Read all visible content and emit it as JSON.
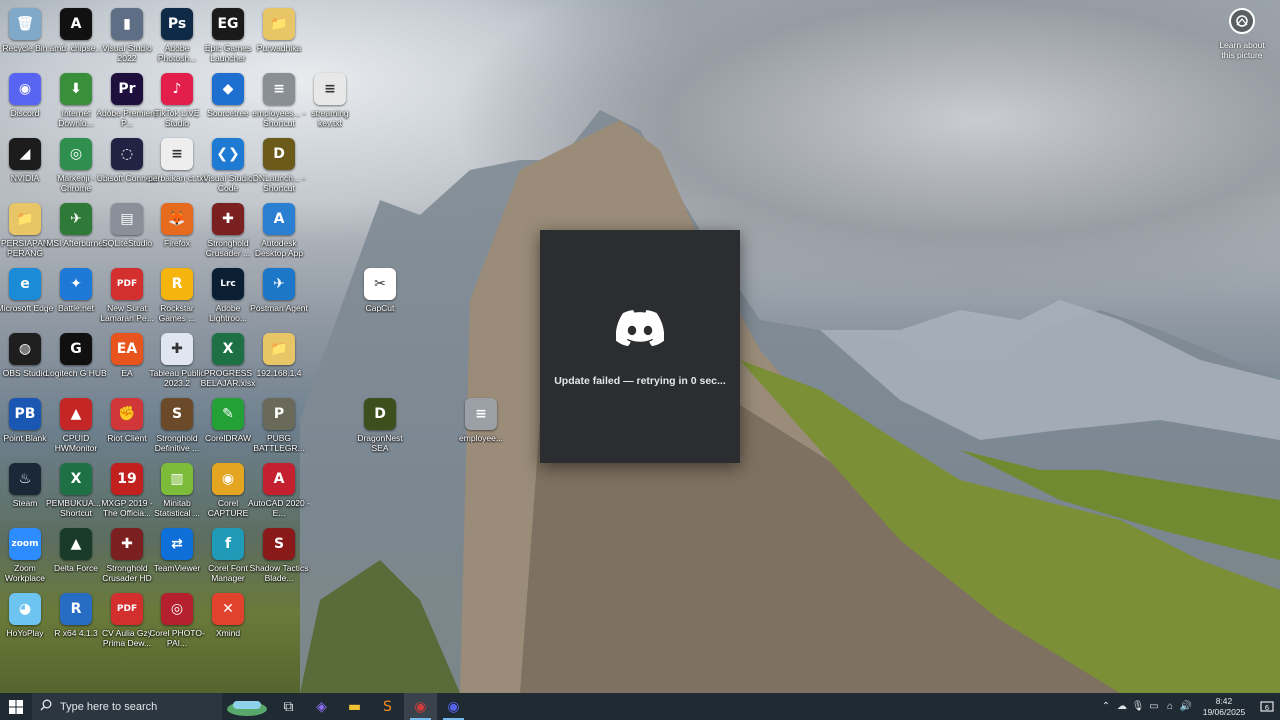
{
  "learn": {
    "label": "Learn about this picture"
  },
  "desktop_icons": [
    {
      "label": "Recycle Bin",
      "glyph": "🗑",
      "color": "#7fa8c9"
    },
    {
      "label": "amd_chipse...",
      "glyph": "A",
      "color": "#111111"
    },
    {
      "label": "Visual Studio 2022",
      "glyph": "▮",
      "color": "#5e6f85"
    },
    {
      "label": "Adobe Photosh...",
      "glyph": "Ps",
      "color": "#0e2a47"
    },
    {
      "label": "Epic Games Launcher",
      "glyph": "EG",
      "color": "#1a1a1a"
    },
    {
      "label": "Purwadhika",
      "glyph": "📁",
      "color": "#e8c667"
    },
    {
      "label": "Discord",
      "glyph": "◉",
      "color": "#5865f2"
    },
    {
      "label": "Internet Downlo...",
      "glyph": "⬇",
      "color": "#3a8f3a"
    },
    {
      "label": "Adobe Premiere P...",
      "glyph": "Pr",
      "color": "#1f0f3d"
    },
    {
      "label": "TikTok LIVE Studio",
      "glyph": "♪",
      "color": "#e41e4a"
    },
    {
      "label": "Sourcetree",
      "glyph": "◆",
      "color": "#1f6fd1"
    },
    {
      "label": "employees... - Shortcut",
      "glyph": "≡",
      "color": "#8a8f95"
    },
    {
      "label": "streaming key.txt",
      "glyph": "≡",
      "color": "#e8e8e8"
    },
    {
      "label": "NVIDIA",
      "glyph": "◢",
      "color": "#1c1c1c"
    },
    {
      "label": "Markenji - Chrome",
      "glyph": "◎",
      "color": "#2f8f4e"
    },
    {
      "label": "Ubisoft Connect",
      "glyph": "◌",
      "color": "#222244"
    },
    {
      "label": "perbaikan ct.txt",
      "glyph": "≡",
      "color": "#eeeeee"
    },
    {
      "label": "Visual Studio Code",
      "glyph": "❮❯",
      "color": "#1f7ad3"
    },
    {
      "label": "DNLaunch... - Shortcut",
      "glyph": "D",
      "color": "#6b5a1a"
    },
    {
      "label": "PERSIAPAN PERANG",
      "glyph": "📁",
      "color": "#e8c667"
    },
    {
      "label": "MSI Afterburner",
      "glyph": "✈",
      "color": "#2f7a38"
    },
    {
      "label": "SQLiteStudio",
      "glyph": "▤",
      "color": "#8a9099"
    },
    {
      "label": "Firefox",
      "glyph": "🦊",
      "color": "#e66b1f"
    },
    {
      "label": "Stronghold Crusader ...",
      "glyph": "✚",
      "color": "#7a2020"
    },
    {
      "label": "Autodesk Desktop App",
      "glyph": "A",
      "color": "#2b7fd3"
    },
    {
      "label": "CapCut",
      "glyph": "✂",
      "color": "#ffffff"
    },
    {
      "label": "Microsoft Edge",
      "glyph": "e",
      "color": "#1b8bd8"
    },
    {
      "label": "Battle.net",
      "glyph": "✦",
      "color": "#1e78d6"
    },
    {
      "label": "New Surat Lamaran Pe...",
      "glyph": "PDF",
      "color": "#d32f2f"
    },
    {
      "label": "Rockstar Games ...",
      "glyph": "R",
      "color": "#f6b40e"
    },
    {
      "label": "Adobe Lightroo...",
      "glyph": "Lrc",
      "color": "#0b1f33"
    },
    {
      "label": "Postman Agent",
      "glyph": "✈",
      "color": "#1d77c9"
    },
    {
      "label": "OBS Studio",
      "glyph": "◍",
      "color": "#1e1e1e"
    },
    {
      "label": "Logitech G HUB",
      "glyph": "G",
      "color": "#101010"
    },
    {
      "label": "EA",
      "glyph": "EA",
      "color": "#e8541e"
    },
    {
      "label": "Tableau Public 2023.2",
      "glyph": "✚",
      "color": "#dfe6ef"
    },
    {
      "label": "PROGRESS BELAJAR.xlsx",
      "glyph": "X",
      "color": "#1e7145"
    },
    {
      "label": "192.168.1.4",
      "glyph": "📁",
      "color": "#e8c667"
    },
    {
      "label": "Point Blank",
      "glyph": "PB",
      "color": "#1a57b3"
    },
    {
      "label": "CPUID HWMonitor",
      "glyph": "▲",
      "color": "#c42525"
    },
    {
      "label": "Riot Client",
      "glyph": "✊",
      "color": "#d13639"
    },
    {
      "label": "Stronghold Definitive ...",
      "glyph": "S",
      "color": "#6b4a2a"
    },
    {
      "label": "CorelDRAW",
      "glyph": "✎",
      "color": "#23a136"
    },
    {
      "label": "PUBG BATTLEGR...",
      "glyph": "P",
      "color": "#6a6a5a"
    },
    {
      "label": "DragonNest SEA",
      "glyph": "D",
      "color": "#3d4f1d"
    },
    {
      "label": "employee...",
      "glyph": "≡",
      "color": "#9aa0a6"
    },
    {
      "label": "Steam",
      "glyph": "♨",
      "color": "#1b2838"
    },
    {
      "label": "PEMBUKUA... - Shortcut",
      "glyph": "X",
      "color": "#1e7145"
    },
    {
      "label": "MXGP 2019 - The Officia...",
      "glyph": "19",
      "color": "#c21f1f"
    },
    {
      "label": "Minitab Statistical ...",
      "glyph": "▥",
      "color": "#7dbb3b"
    },
    {
      "label": "Corel CAPTURE",
      "glyph": "◉",
      "color": "#e4a521"
    },
    {
      "label": "AutoCAD 2020 - E...",
      "glyph": "A",
      "color": "#c5202f"
    },
    {
      "label": "Zoom Workplace",
      "glyph": "zoom",
      "color": "#2d8cff"
    },
    {
      "label": "Delta Force",
      "glyph": "▲",
      "color": "#1a3a2a"
    },
    {
      "label": "Stronghold Crusader HD",
      "glyph": "✚",
      "color": "#7a2020"
    },
    {
      "label": "TeamViewer",
      "glyph": "⇄",
      "color": "#0e6fd8"
    },
    {
      "label": "Corel Font Manager",
      "glyph": "f",
      "color": "#1f9bb8"
    },
    {
      "label": "Shadow Tactics Blade...",
      "glyph": "S",
      "color": "#8a1a1a"
    },
    {
      "label": "HoYoPlay",
      "glyph": "◕",
      "color": "#6ec4f0"
    },
    {
      "label": "R x64 4.1.3",
      "glyph": "R",
      "color": "#276dc3"
    },
    {
      "label": "CV Aulia Gzy Prima Dew...",
      "glyph": "PDF",
      "color": "#d32f2f"
    },
    {
      "label": "Corel PHOTO-PAI...",
      "glyph": "◎",
      "color": "#b5202f"
    },
    {
      "label": "Xmind",
      "glyph": "✕",
      "color": "#e0422e"
    }
  ],
  "updater": {
    "status": "Update failed — retrying in 0 sec..."
  },
  "taskbar": {
    "search_placeholder": "Type here to search",
    "apps": [
      {
        "name": "task-view",
        "glyph": "⧉",
        "color": "#e3e6ea"
      },
      {
        "name": "copilot",
        "glyph": "◈",
        "color": "#8a6cf0"
      },
      {
        "name": "file-explorer",
        "glyph": "▬",
        "color": "#f2c231"
      },
      {
        "name": "sublime",
        "glyph": "S",
        "color": "#f58c1f"
      },
      {
        "name": "chrome",
        "glyph": "◉",
        "color": "#d23b3b"
      },
      {
        "name": "discord",
        "glyph": "◉",
        "color": "#5865f2"
      }
    ],
    "time": "8:42",
    "date": "19/06/2025",
    "notification_count": "6"
  }
}
